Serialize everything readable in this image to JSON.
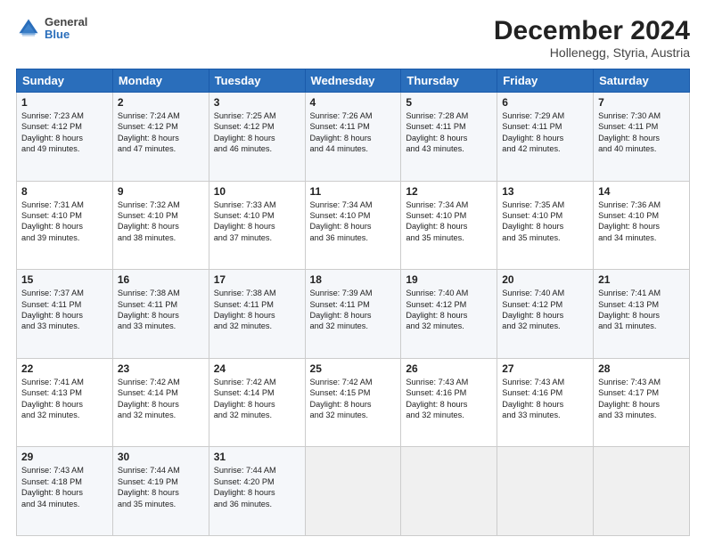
{
  "header": {
    "logo_general": "General",
    "logo_blue": "Blue",
    "month_title": "December 2024",
    "location": "Hollenegg, Styria, Austria"
  },
  "weekdays": [
    "Sunday",
    "Monday",
    "Tuesday",
    "Wednesday",
    "Thursday",
    "Friday",
    "Saturday"
  ],
  "weeks": [
    [
      {
        "day": "1",
        "lines": [
          "Sunrise: 7:23 AM",
          "Sunset: 4:12 PM",
          "Daylight: 8 hours",
          "and 49 minutes."
        ]
      },
      {
        "day": "2",
        "lines": [
          "Sunrise: 7:24 AM",
          "Sunset: 4:12 PM",
          "Daylight: 8 hours",
          "and 47 minutes."
        ]
      },
      {
        "day": "3",
        "lines": [
          "Sunrise: 7:25 AM",
          "Sunset: 4:12 PM",
          "Daylight: 8 hours",
          "and 46 minutes."
        ]
      },
      {
        "day": "4",
        "lines": [
          "Sunrise: 7:26 AM",
          "Sunset: 4:11 PM",
          "Daylight: 8 hours",
          "and 44 minutes."
        ]
      },
      {
        "day": "5",
        "lines": [
          "Sunrise: 7:28 AM",
          "Sunset: 4:11 PM",
          "Daylight: 8 hours",
          "and 43 minutes."
        ]
      },
      {
        "day": "6",
        "lines": [
          "Sunrise: 7:29 AM",
          "Sunset: 4:11 PM",
          "Daylight: 8 hours",
          "and 42 minutes."
        ]
      },
      {
        "day": "7",
        "lines": [
          "Sunrise: 7:30 AM",
          "Sunset: 4:11 PM",
          "Daylight: 8 hours",
          "and 40 minutes."
        ]
      }
    ],
    [
      {
        "day": "8",
        "lines": [
          "Sunrise: 7:31 AM",
          "Sunset: 4:10 PM",
          "Daylight: 8 hours",
          "and 39 minutes."
        ]
      },
      {
        "day": "9",
        "lines": [
          "Sunrise: 7:32 AM",
          "Sunset: 4:10 PM",
          "Daylight: 8 hours",
          "and 38 minutes."
        ]
      },
      {
        "day": "10",
        "lines": [
          "Sunrise: 7:33 AM",
          "Sunset: 4:10 PM",
          "Daylight: 8 hours",
          "and 37 minutes."
        ]
      },
      {
        "day": "11",
        "lines": [
          "Sunrise: 7:34 AM",
          "Sunset: 4:10 PM",
          "Daylight: 8 hours",
          "and 36 minutes."
        ]
      },
      {
        "day": "12",
        "lines": [
          "Sunrise: 7:34 AM",
          "Sunset: 4:10 PM",
          "Daylight: 8 hours",
          "and 35 minutes."
        ]
      },
      {
        "day": "13",
        "lines": [
          "Sunrise: 7:35 AM",
          "Sunset: 4:10 PM",
          "Daylight: 8 hours",
          "and 35 minutes."
        ]
      },
      {
        "day": "14",
        "lines": [
          "Sunrise: 7:36 AM",
          "Sunset: 4:10 PM",
          "Daylight: 8 hours",
          "and 34 minutes."
        ]
      }
    ],
    [
      {
        "day": "15",
        "lines": [
          "Sunrise: 7:37 AM",
          "Sunset: 4:11 PM",
          "Daylight: 8 hours",
          "and 33 minutes."
        ]
      },
      {
        "day": "16",
        "lines": [
          "Sunrise: 7:38 AM",
          "Sunset: 4:11 PM",
          "Daylight: 8 hours",
          "and 33 minutes."
        ]
      },
      {
        "day": "17",
        "lines": [
          "Sunrise: 7:38 AM",
          "Sunset: 4:11 PM",
          "Daylight: 8 hours",
          "and 32 minutes."
        ]
      },
      {
        "day": "18",
        "lines": [
          "Sunrise: 7:39 AM",
          "Sunset: 4:11 PM",
          "Daylight: 8 hours",
          "and 32 minutes."
        ]
      },
      {
        "day": "19",
        "lines": [
          "Sunrise: 7:40 AM",
          "Sunset: 4:12 PM",
          "Daylight: 8 hours",
          "and 32 minutes."
        ]
      },
      {
        "day": "20",
        "lines": [
          "Sunrise: 7:40 AM",
          "Sunset: 4:12 PM",
          "Daylight: 8 hours",
          "and 32 minutes."
        ]
      },
      {
        "day": "21",
        "lines": [
          "Sunrise: 7:41 AM",
          "Sunset: 4:13 PM",
          "Daylight: 8 hours",
          "and 31 minutes."
        ]
      }
    ],
    [
      {
        "day": "22",
        "lines": [
          "Sunrise: 7:41 AM",
          "Sunset: 4:13 PM",
          "Daylight: 8 hours",
          "and 32 minutes."
        ]
      },
      {
        "day": "23",
        "lines": [
          "Sunrise: 7:42 AM",
          "Sunset: 4:14 PM",
          "Daylight: 8 hours",
          "and 32 minutes."
        ]
      },
      {
        "day": "24",
        "lines": [
          "Sunrise: 7:42 AM",
          "Sunset: 4:14 PM",
          "Daylight: 8 hours",
          "and 32 minutes."
        ]
      },
      {
        "day": "25",
        "lines": [
          "Sunrise: 7:42 AM",
          "Sunset: 4:15 PM",
          "Daylight: 8 hours",
          "and 32 minutes."
        ]
      },
      {
        "day": "26",
        "lines": [
          "Sunrise: 7:43 AM",
          "Sunset: 4:16 PM",
          "Daylight: 8 hours",
          "and 32 minutes."
        ]
      },
      {
        "day": "27",
        "lines": [
          "Sunrise: 7:43 AM",
          "Sunset: 4:16 PM",
          "Daylight: 8 hours",
          "and 33 minutes."
        ]
      },
      {
        "day": "28",
        "lines": [
          "Sunrise: 7:43 AM",
          "Sunset: 4:17 PM",
          "Daylight: 8 hours",
          "and 33 minutes."
        ]
      }
    ],
    [
      {
        "day": "29",
        "lines": [
          "Sunrise: 7:43 AM",
          "Sunset: 4:18 PM",
          "Daylight: 8 hours",
          "and 34 minutes."
        ]
      },
      {
        "day": "30",
        "lines": [
          "Sunrise: 7:44 AM",
          "Sunset: 4:19 PM",
          "Daylight: 8 hours",
          "and 35 minutes."
        ]
      },
      {
        "day": "31",
        "lines": [
          "Sunrise: 7:44 AM",
          "Sunset: 4:20 PM",
          "Daylight: 8 hours",
          "and 36 minutes."
        ]
      },
      null,
      null,
      null,
      null
    ]
  ]
}
